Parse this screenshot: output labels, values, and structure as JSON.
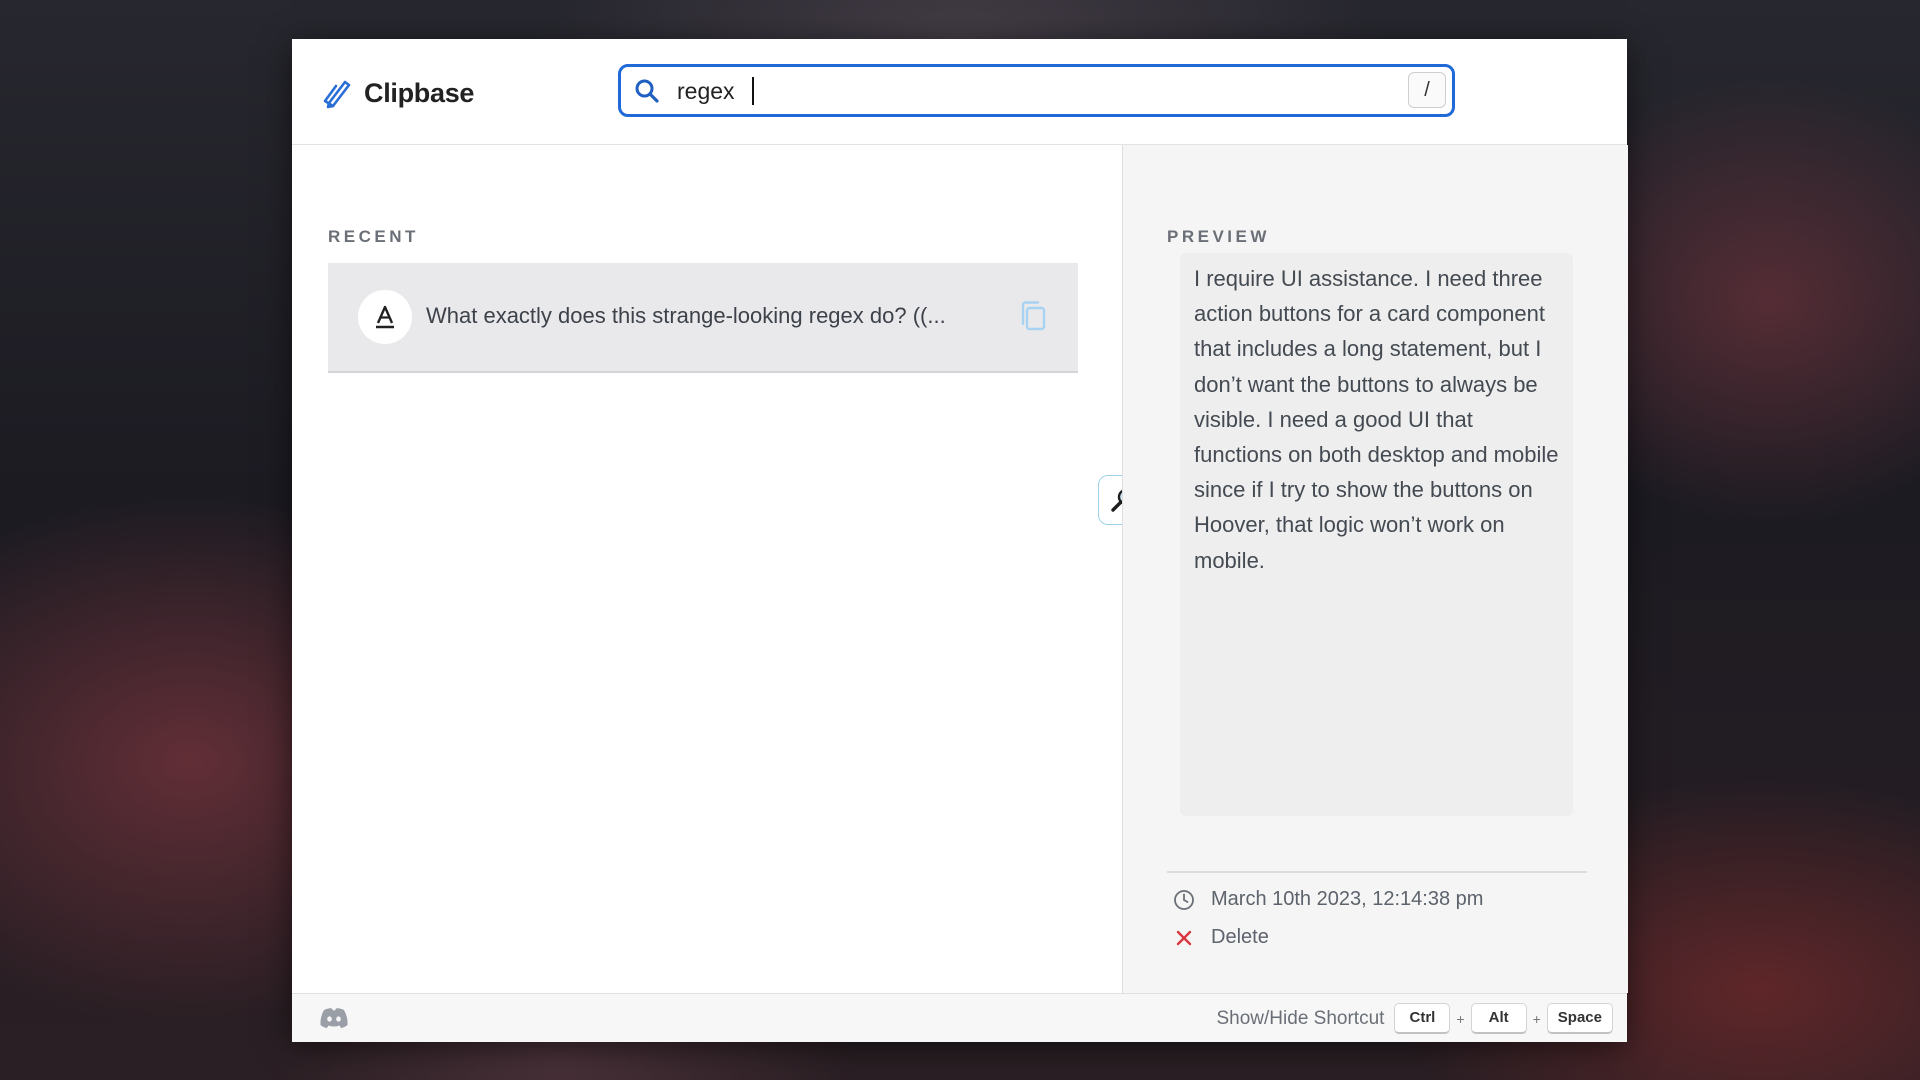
{
  "app": {
    "name": "Clipbase",
    "logo_icon": "paperclip-pen-icon",
    "accent_color": "#1f6ad8"
  },
  "search": {
    "value": "regex",
    "shortcut_key": "/"
  },
  "recent": {
    "label": "RECENT",
    "items": [
      {
        "type_icon": "text-a-icon",
        "text": "What exactly does this strange-looking regex do? ((...",
        "action_icon": "copy-icon"
      }
    ]
  },
  "preview": {
    "label": "PREVIEW",
    "text": "I require UI assistance. I need three action buttons for a card component that includes a long statement, but I don’t want the buttons to always be visible. I need a good UI that functions on both desktop and mobile since if I try to show the buttons on Hoover, that logic won’t work on mobile.",
    "timestamp": "March 10th 2023, 12:14:38 pm",
    "delete_label": "Delete",
    "delete_color": "#d9363e"
  },
  "footer": {
    "discord_icon": "discord-icon",
    "shortcut_label": "Show/Hide Shortcut",
    "keys": [
      "Ctrl",
      "Alt",
      "Space"
    ],
    "separator": "+"
  }
}
